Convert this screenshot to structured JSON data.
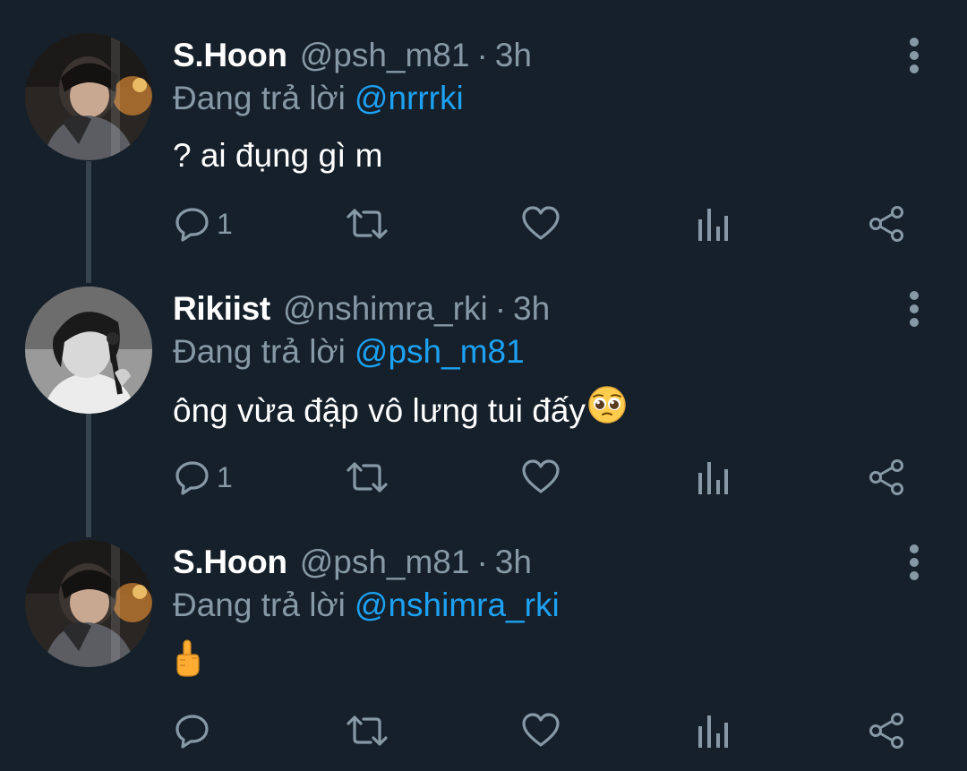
{
  "tweets": [
    {
      "display_name": "S.Hoon",
      "handle": "@psh_m81",
      "separator": "·",
      "time": "3h",
      "reply_prefix": "Đang trả lời",
      "reply_to": "@nrrrki",
      "text": "? ai đụng gì m",
      "reply_count": "1",
      "avatar_icon": "avatar-photo-shoon"
    },
    {
      "display_name": "Rikiist",
      "handle": "@nshimra_rki",
      "separator": "·",
      "time": "3h",
      "reply_prefix": "Đang trả lời",
      "reply_to": "@psh_m81",
      "text": "ông vừa đập vô lưng tui đấy",
      "text_emoji": "pleading-face-emoji",
      "reply_count": "1",
      "avatar_icon": "avatar-photo-rikiist"
    },
    {
      "display_name": "S.Hoon",
      "handle": "@psh_m81",
      "separator": "·",
      "time": "3h",
      "reply_prefix": "Đang trả lời",
      "reply_to": "@nshimra_rki",
      "text": "",
      "text_emoji": "middle-finger-emoji",
      "reply_count": "",
      "avatar_icon": "avatar-photo-shoon"
    }
  ],
  "action_icons": [
    "reply-icon",
    "retweet-icon",
    "like-icon",
    "analytics-icon",
    "share-icon"
  ],
  "colors": {
    "background": "#15202b",
    "primary_text": "#ffffff",
    "secondary_text": "#8899a6",
    "link": "#1da1f2",
    "thread_line": "#38444d"
  }
}
